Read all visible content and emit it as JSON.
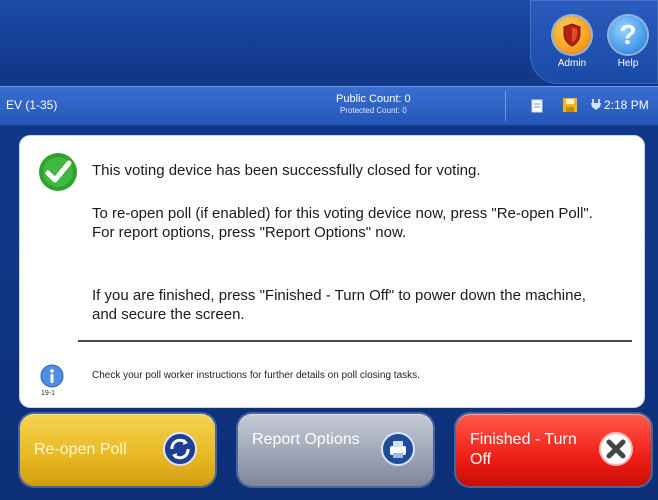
{
  "header": {
    "admin_label": "Admin",
    "help_label": "Help",
    "help_glyph": "?"
  },
  "status_bar": {
    "ev_label": "EV (1-35)",
    "public_count": "Public Count: 0",
    "protected_count": "Protected Count: 0",
    "time": "2:18 PM",
    "icons": [
      "document-icon",
      "save-icon",
      "power-plug-icon"
    ]
  },
  "message": {
    "line1": "This voting device has been successfully closed for voting.",
    "line2": "To re-open poll (if enabled) for this voting device now, press \"Re-open Poll\".",
    "line3": "For report options, press \"Report Options\" now.",
    "line4": "If you are finished, press \"Finished - Turn Off\" to power down the machine, and secure the screen.",
    "info_text": "Check your poll worker instructions for further details on poll closing tasks.",
    "info_sub": "19-1"
  },
  "buttons": {
    "reopen": "Re-open Poll",
    "report": "Report Options",
    "finish": "Finished - Turn Off"
  },
  "colors": {
    "background": "#123a8c",
    "reopen": "#e8b822",
    "report": "#9aa2b3",
    "finish": "#ef1f16",
    "check": "#2ea12e"
  }
}
